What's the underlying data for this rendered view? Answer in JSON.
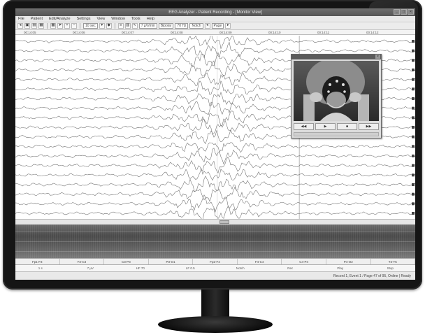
{
  "window": {
    "title": "EEG Analyzer - Patient Recording - [Monitor View]"
  },
  "menu": {
    "items": [
      "File",
      "Patient",
      "Edit/Analyze",
      "Settings",
      "View",
      "Window",
      "Tools",
      "Help"
    ]
  },
  "toolbar": {
    "zoom_value": "10 sec",
    "sensitivity_value": "7 µV/mm",
    "montage_value": "Bipolar",
    "filter_value": "70 Hz",
    "notch_value": "Notch",
    "page_value": "Page"
  },
  "timeaxis": {
    "labels": [
      "00:14:05",
      "00:14:06",
      "00:14:07",
      "00:14:08",
      "00:14:09",
      "00:14:10",
      "00:14:11",
      "00:14:12"
    ]
  },
  "channel_bar": {
    "cells": [
      "Fp1-F3",
      "F3-C3",
      "C3-P3",
      "P3-O1",
      "Fp2-F4",
      "F4-C4",
      "C4-P4",
      "P4-O2",
      "T3-T5"
    ]
  },
  "info_row": {
    "cells": [
      "1 s",
      "7 µV",
      "HF 70",
      "LF 0.5",
      "Notch",
      "Rec",
      "Play",
      "Stop"
    ]
  },
  "statusbar": {
    "text": "Record 1, Event 1 / Page 47 of 95, Online  |  Ready"
  },
  "video": {
    "controls": [
      "◀◀",
      "▶",
      "■",
      "▶▶"
    ]
  },
  "colors": {
    "bezel": "#151515",
    "trace": "#6a6a6a",
    "titlebar": "#5b5b5b"
  }
}
